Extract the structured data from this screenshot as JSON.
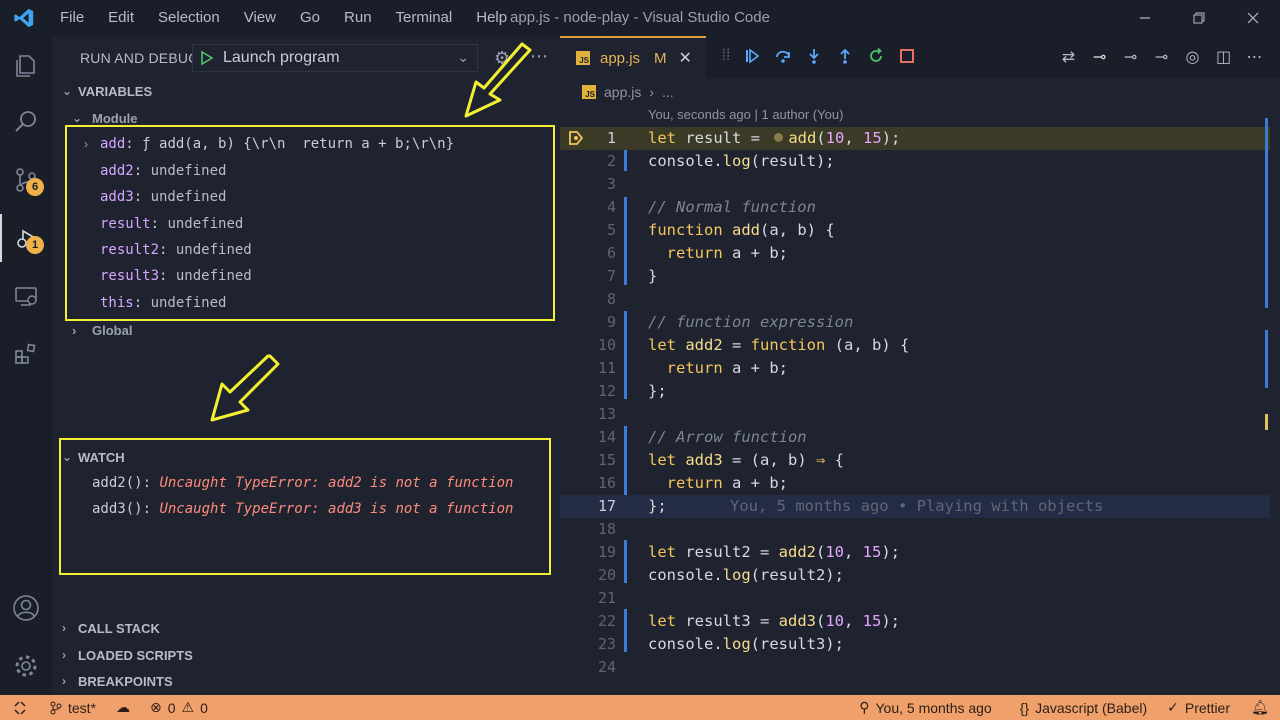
{
  "titlebar": {
    "menu": [
      "File",
      "Edit",
      "Selection",
      "View",
      "Go",
      "Run",
      "Terminal",
      "Help"
    ],
    "title": "app.js - node-play - Visual Studio Code"
  },
  "activity": {
    "source_control_badge": "6",
    "debug_badge": "1"
  },
  "sidebar": {
    "title": "RUN AND DEBUG",
    "launch_config": "Launch program",
    "variables_header": "VARIABLES",
    "module_scope": "Module",
    "global_scope": "Global",
    "variables": [
      {
        "name": "add",
        "sep": ": ",
        "value": "ƒ add(a, b) {\\r\\n  return a + b;\\r\\n}"
      },
      {
        "name": "add2",
        "sep": ": ",
        "value": "undefined"
      },
      {
        "name": "add3",
        "sep": ": ",
        "value": "undefined"
      },
      {
        "name": "result",
        "sep": ": ",
        "value": "undefined"
      },
      {
        "name": "result2",
        "sep": ": ",
        "value": "undefined"
      },
      {
        "name": "result3",
        "sep": ": ",
        "value": "undefined"
      },
      {
        "name": "this",
        "sep": ": ",
        "value": "undefined"
      }
    ],
    "watch_header": "WATCH",
    "watch": [
      {
        "expr": "add2(): ",
        "value": "Uncaught TypeError: add2 is not a function"
      },
      {
        "expr": "add3(): ",
        "value": "Uncaught TypeError: add3 is not a function"
      }
    ],
    "call_stack": "CALL STACK",
    "loaded_scripts": "LOADED SCRIPTS",
    "breakpoints": "BREAKPOINTS"
  },
  "editor": {
    "tab_name": "app.js",
    "tab_modified": "M",
    "breadcrumb_file": "app.js",
    "breadcrumb_more": "...",
    "codelens": "You, seconds ago | 1 author (You)",
    "blame": "You, 5 months ago • Playing with objects",
    "line_numbers": [
      "1",
      "2",
      "3",
      "4",
      "5",
      "6",
      "7",
      "8",
      "9",
      "10",
      "11",
      "12",
      "13",
      "14",
      "15",
      "16",
      "17",
      "18",
      "19",
      "20",
      "21",
      "22",
      "23",
      "24"
    ]
  },
  "statusbar": {
    "branch": "test*",
    "errors": "0",
    "warnings": "0",
    "blame": "You, 5 months ago",
    "language": "Javascript (Babel)",
    "formatter": "Prettier"
  },
  "colors": {
    "accent": "#f0a06a",
    "highlight_box": "#f3f032",
    "error_text": "#ff8a7a"
  }
}
